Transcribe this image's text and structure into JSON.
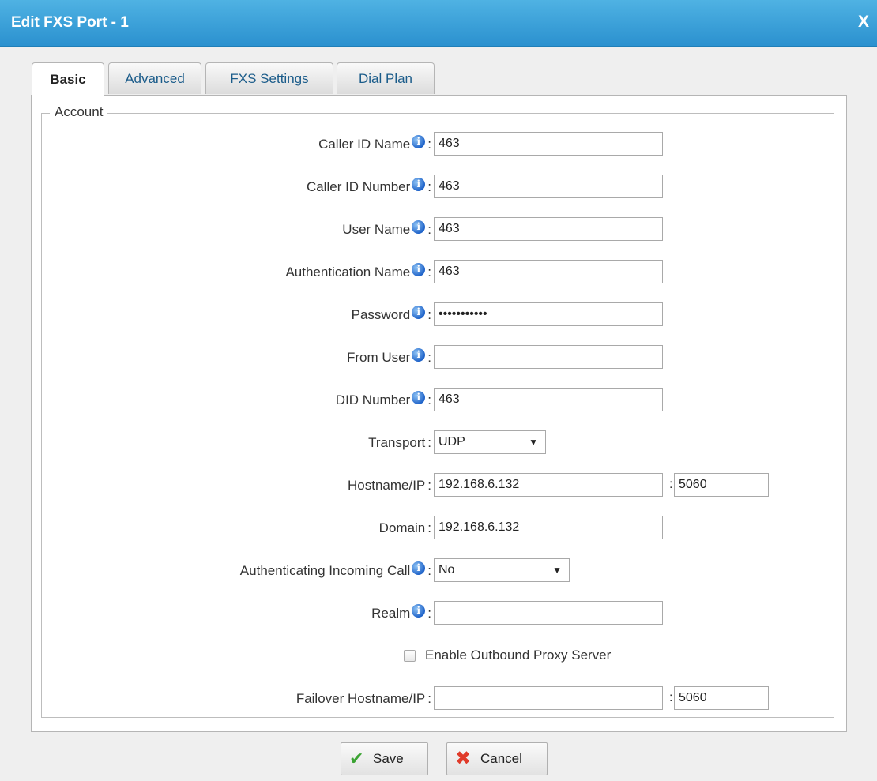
{
  "dialog": {
    "title": "Edit FXS Port - 1",
    "close_label": "X"
  },
  "tabs": [
    {
      "label": "Basic",
      "active": true
    },
    {
      "label": "Advanced",
      "active": false
    },
    {
      "label": "FXS Settings",
      "active": false
    },
    {
      "label": "Dial Plan",
      "active": false
    }
  ],
  "account": {
    "legend": "Account",
    "fields": {
      "caller_id_name": {
        "label": "Caller ID Name",
        "value": "463"
      },
      "caller_id_number": {
        "label": "Caller ID Number",
        "value": "463"
      },
      "user_name": {
        "label": "User Name",
        "value": "463"
      },
      "authentication_name": {
        "label": "Authentication Name",
        "value": "463"
      },
      "password": {
        "label": "Password",
        "value": "•••••••••••"
      },
      "from_user": {
        "label": "From User",
        "value": ""
      },
      "did_number": {
        "label": "DID Number",
        "value": "463"
      },
      "transport": {
        "label": "Transport",
        "value": "UDP"
      },
      "hostname": {
        "label": "Hostname/IP",
        "value": "192.168.6.132",
        "port": "5060"
      },
      "domain": {
        "label": "Domain",
        "value": "192.168.6.132"
      },
      "auth_incoming": {
        "label": "Authenticating Incoming Call",
        "value": "No"
      },
      "realm": {
        "label": "Realm",
        "value": ""
      },
      "outbound_proxy": {
        "label": "Enable Outbound Proxy Server",
        "checked": false
      },
      "failover_hostname": {
        "label": "Failover Hostname/IP",
        "value": "",
        "port": "5060"
      }
    }
  },
  "buttons": {
    "save": "Save",
    "cancel": "Cancel"
  },
  "icons": {
    "info": "i",
    "save": "✔",
    "cancel": "✖",
    "caret": "▼"
  },
  "colors": {
    "titlebar": "#2b91cf",
    "tab_text": "#1b5c8a",
    "info_icon": "#1f63c9",
    "save_icon": "#3aa332",
    "cancel_icon": "#e03b2a"
  }
}
